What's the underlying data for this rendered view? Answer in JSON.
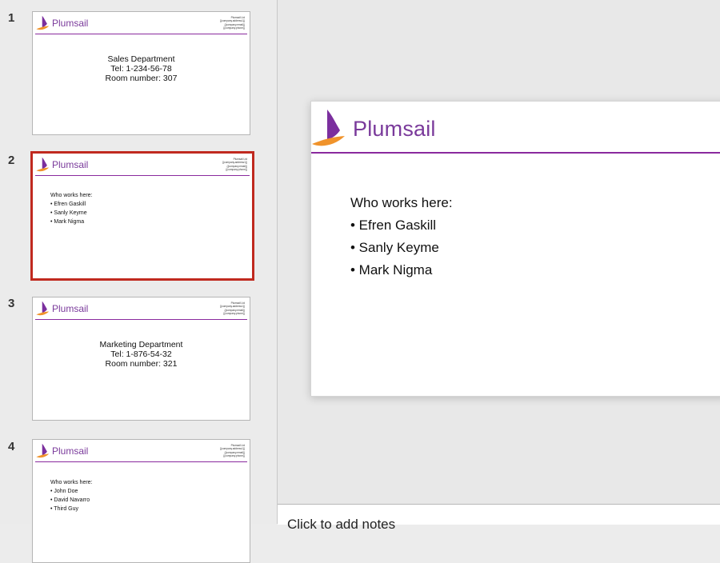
{
  "brand": "Plumsail",
  "colors": {
    "accent": "#8a2a9e",
    "brand_text": "#7a3a9b",
    "logo_purple": "#7b2f9e",
    "logo_orange": "#f0932b",
    "selection": "#c0291f"
  },
  "thumb_address": [
    "Plumsail Ltd",
    "{{company.address1}}",
    "{{company.email}}",
    "{{company.phone}}"
  ],
  "slides": [
    {
      "number": "1",
      "lines": [
        "Sales Department",
        "Tel: 1-234-56-78",
        "Room number: 307"
      ]
    },
    {
      "number": "2",
      "heading": "Who works here:",
      "bullets": [
        "• Efren Gaskill",
        "• Sanly Keyme",
        "• Mark Nigma"
      ]
    },
    {
      "number": "3",
      "lines": [
        "Marketing Department",
        "Tel: 1-876-54-32",
        "Room number: 321"
      ]
    },
    {
      "number": "4",
      "heading": "Who works here:",
      "bullets": [
        "• John Doe",
        "• David Navarro",
        "• Third Guy"
      ]
    }
  ],
  "current_slide": {
    "heading": "Who works here:",
    "bullets": [
      "• Efren Gaskill",
      "• Sanly Keyme",
      "• Mark Nigma"
    ]
  },
  "notes_placeholder": "Click to add notes"
}
